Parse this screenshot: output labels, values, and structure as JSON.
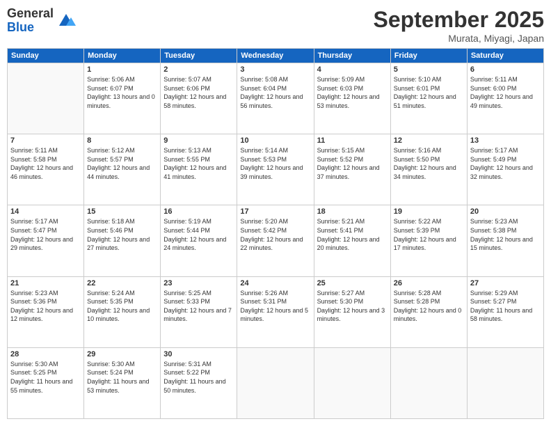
{
  "header": {
    "logo": {
      "text_general": "General",
      "text_blue": "Blue"
    },
    "month": "September 2025",
    "location": "Murata, Miyagi, Japan"
  },
  "days_of_week": [
    "Sunday",
    "Monday",
    "Tuesday",
    "Wednesday",
    "Thursday",
    "Friday",
    "Saturday"
  ],
  "weeks": [
    [
      {
        "day": "",
        "sunrise": "",
        "sunset": "",
        "daylight": ""
      },
      {
        "day": "1",
        "sunrise": "Sunrise: 5:06 AM",
        "sunset": "Sunset: 6:07 PM",
        "daylight": "Daylight: 13 hours and 0 minutes."
      },
      {
        "day": "2",
        "sunrise": "Sunrise: 5:07 AM",
        "sunset": "Sunset: 6:06 PM",
        "daylight": "Daylight: 12 hours and 58 minutes."
      },
      {
        "day": "3",
        "sunrise": "Sunrise: 5:08 AM",
        "sunset": "Sunset: 6:04 PM",
        "daylight": "Daylight: 12 hours and 56 minutes."
      },
      {
        "day": "4",
        "sunrise": "Sunrise: 5:09 AM",
        "sunset": "Sunset: 6:03 PM",
        "daylight": "Daylight: 12 hours and 53 minutes."
      },
      {
        "day": "5",
        "sunrise": "Sunrise: 5:10 AM",
        "sunset": "Sunset: 6:01 PM",
        "daylight": "Daylight: 12 hours and 51 minutes."
      },
      {
        "day": "6",
        "sunrise": "Sunrise: 5:11 AM",
        "sunset": "Sunset: 6:00 PM",
        "daylight": "Daylight: 12 hours and 49 minutes."
      }
    ],
    [
      {
        "day": "7",
        "sunrise": "Sunrise: 5:11 AM",
        "sunset": "Sunset: 5:58 PM",
        "daylight": "Daylight: 12 hours and 46 minutes."
      },
      {
        "day": "8",
        "sunrise": "Sunrise: 5:12 AM",
        "sunset": "Sunset: 5:57 PM",
        "daylight": "Daylight: 12 hours and 44 minutes."
      },
      {
        "day": "9",
        "sunrise": "Sunrise: 5:13 AM",
        "sunset": "Sunset: 5:55 PM",
        "daylight": "Daylight: 12 hours and 41 minutes."
      },
      {
        "day": "10",
        "sunrise": "Sunrise: 5:14 AM",
        "sunset": "Sunset: 5:53 PM",
        "daylight": "Daylight: 12 hours and 39 minutes."
      },
      {
        "day": "11",
        "sunrise": "Sunrise: 5:15 AM",
        "sunset": "Sunset: 5:52 PM",
        "daylight": "Daylight: 12 hours and 37 minutes."
      },
      {
        "day": "12",
        "sunrise": "Sunrise: 5:16 AM",
        "sunset": "Sunset: 5:50 PM",
        "daylight": "Daylight: 12 hours and 34 minutes."
      },
      {
        "day": "13",
        "sunrise": "Sunrise: 5:17 AM",
        "sunset": "Sunset: 5:49 PM",
        "daylight": "Daylight: 12 hours and 32 minutes."
      }
    ],
    [
      {
        "day": "14",
        "sunrise": "Sunrise: 5:17 AM",
        "sunset": "Sunset: 5:47 PM",
        "daylight": "Daylight: 12 hours and 29 minutes."
      },
      {
        "day": "15",
        "sunrise": "Sunrise: 5:18 AM",
        "sunset": "Sunset: 5:46 PM",
        "daylight": "Daylight: 12 hours and 27 minutes."
      },
      {
        "day": "16",
        "sunrise": "Sunrise: 5:19 AM",
        "sunset": "Sunset: 5:44 PM",
        "daylight": "Daylight: 12 hours and 24 minutes."
      },
      {
        "day": "17",
        "sunrise": "Sunrise: 5:20 AM",
        "sunset": "Sunset: 5:42 PM",
        "daylight": "Daylight: 12 hours and 22 minutes."
      },
      {
        "day": "18",
        "sunrise": "Sunrise: 5:21 AM",
        "sunset": "Sunset: 5:41 PM",
        "daylight": "Daylight: 12 hours and 20 minutes."
      },
      {
        "day": "19",
        "sunrise": "Sunrise: 5:22 AM",
        "sunset": "Sunset: 5:39 PM",
        "daylight": "Daylight: 12 hours and 17 minutes."
      },
      {
        "day": "20",
        "sunrise": "Sunrise: 5:23 AM",
        "sunset": "Sunset: 5:38 PM",
        "daylight": "Daylight: 12 hours and 15 minutes."
      }
    ],
    [
      {
        "day": "21",
        "sunrise": "Sunrise: 5:23 AM",
        "sunset": "Sunset: 5:36 PM",
        "daylight": "Daylight: 12 hours and 12 minutes."
      },
      {
        "day": "22",
        "sunrise": "Sunrise: 5:24 AM",
        "sunset": "Sunset: 5:35 PM",
        "daylight": "Daylight: 12 hours and 10 minutes."
      },
      {
        "day": "23",
        "sunrise": "Sunrise: 5:25 AM",
        "sunset": "Sunset: 5:33 PM",
        "daylight": "Daylight: 12 hours and 7 minutes."
      },
      {
        "day": "24",
        "sunrise": "Sunrise: 5:26 AM",
        "sunset": "Sunset: 5:31 PM",
        "daylight": "Daylight: 12 hours and 5 minutes."
      },
      {
        "day": "25",
        "sunrise": "Sunrise: 5:27 AM",
        "sunset": "Sunset: 5:30 PM",
        "daylight": "Daylight: 12 hours and 3 minutes."
      },
      {
        "day": "26",
        "sunrise": "Sunrise: 5:28 AM",
        "sunset": "Sunset: 5:28 PM",
        "daylight": "Daylight: 12 hours and 0 minutes."
      },
      {
        "day": "27",
        "sunrise": "Sunrise: 5:29 AM",
        "sunset": "Sunset: 5:27 PM",
        "daylight": "Daylight: 11 hours and 58 minutes."
      }
    ],
    [
      {
        "day": "28",
        "sunrise": "Sunrise: 5:30 AM",
        "sunset": "Sunset: 5:25 PM",
        "daylight": "Daylight: 11 hours and 55 minutes."
      },
      {
        "day": "29",
        "sunrise": "Sunrise: 5:30 AM",
        "sunset": "Sunset: 5:24 PM",
        "daylight": "Daylight: 11 hours and 53 minutes."
      },
      {
        "day": "30",
        "sunrise": "Sunrise: 5:31 AM",
        "sunset": "Sunset: 5:22 PM",
        "daylight": "Daylight: 11 hours and 50 minutes."
      },
      {
        "day": "",
        "sunrise": "",
        "sunset": "",
        "daylight": ""
      },
      {
        "day": "",
        "sunrise": "",
        "sunset": "",
        "daylight": ""
      },
      {
        "day": "",
        "sunrise": "",
        "sunset": "",
        "daylight": ""
      },
      {
        "day": "",
        "sunrise": "",
        "sunset": "",
        "daylight": ""
      }
    ]
  ]
}
